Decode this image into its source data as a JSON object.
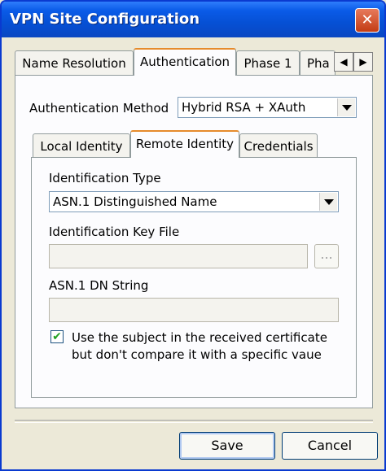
{
  "window": {
    "title": "VPN Site Configuration",
    "close_glyph": "✕"
  },
  "tabs": [
    {
      "label": "Name Resolution"
    },
    {
      "label": "Authentication"
    },
    {
      "label": "Phase 1"
    },
    {
      "label": "Pha"
    }
  ],
  "tab_scroll": {
    "left_glyph": "◀",
    "right_glyph": "▶"
  },
  "auth_method": {
    "label": "Authentication Method",
    "value": "Hybrid RSA + XAuth"
  },
  "subtabs": [
    {
      "label": "Local Identity"
    },
    {
      "label": "Remote Identity"
    },
    {
      "label": "Credentials"
    }
  ],
  "identification_type": {
    "label": "Identification Type",
    "value": "ASN.1 Distinguished Name"
  },
  "key_file": {
    "label": "Identification Key File",
    "value": "",
    "browse_label": "..."
  },
  "dn_string": {
    "label": "ASN.1 DN String",
    "value": ""
  },
  "subject_checkbox": {
    "checked": true,
    "check_glyph": "✔",
    "line1": "Use the subject in the received certificate",
    "line2": "but don't compare it with a specific vaue"
  },
  "buttons": {
    "save": "Save",
    "cancel": "Cancel"
  }
}
